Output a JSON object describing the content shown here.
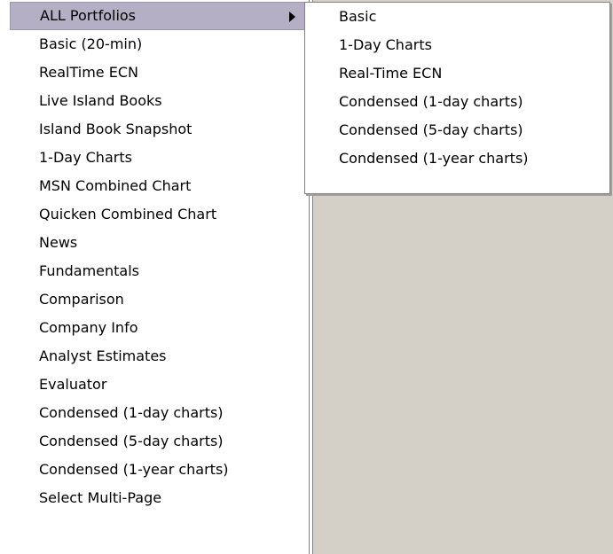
{
  "main_menu": {
    "items": [
      {
        "label": "ALL Portfolios"
      },
      {
        "label": "Basic (20-min)"
      },
      {
        "label": "RealTime ECN"
      },
      {
        "label": "Live Island Books"
      },
      {
        "label": "Island Book Snapshot"
      },
      {
        "label": "1-Day Charts"
      },
      {
        "label": "MSN Combined Chart"
      },
      {
        "label": "Quicken Combined Chart"
      },
      {
        "label": "News"
      },
      {
        "label": "Fundamentals"
      },
      {
        "label": "Comparison"
      },
      {
        "label": "Company Info"
      },
      {
        "label": "Analyst Estimates"
      },
      {
        "label": "Evaluator"
      },
      {
        "label": "Condensed (1-day charts)"
      },
      {
        "label": "Condensed (5-day charts)"
      },
      {
        "label": "Condensed (1-year charts)"
      },
      {
        "label": "Select Multi-Page"
      }
    ],
    "highlighted_item": "ALL Portfolios",
    "highlight_color": "#b5afc6"
  },
  "submenu": {
    "parent": "ALL Portfolios",
    "items": [
      {
        "label": "Basic"
      },
      {
        "label": "1-Day Charts"
      },
      {
        "label": "Real-Time ECN"
      },
      {
        "label": "Condensed (1-day charts)"
      },
      {
        "label": "Condensed (5-day charts)"
      },
      {
        "label": "Condensed (1-year charts)"
      }
    ]
  },
  "colors": {
    "workspace": "#d4d0c8",
    "menu_background": "#ffffff",
    "border": "#808080"
  }
}
